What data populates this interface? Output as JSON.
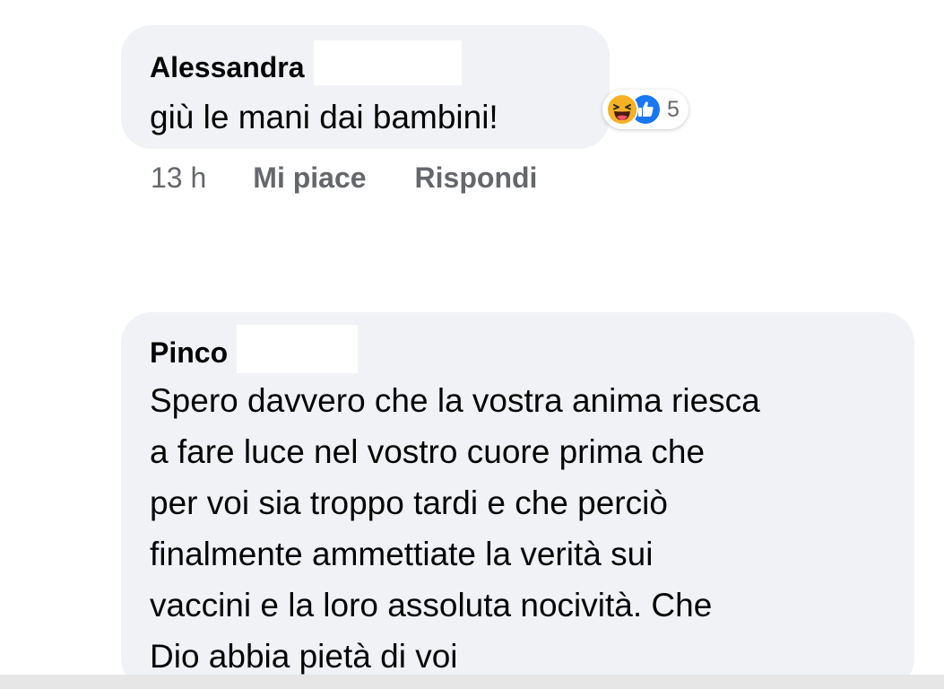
{
  "comments": [
    {
      "author": "Alessandra",
      "text_lines": [
        "giù le mani dai bambini!"
      ],
      "reactions": {
        "icons": [
          "haha-icon",
          "like-icon"
        ],
        "count": "5"
      },
      "actions": {
        "time": "13 h",
        "like_label": "Mi piace",
        "reply_label": "Rispondi"
      }
    },
    {
      "author": "Pinco",
      "text_lines": [
        "Spero davvero che la vostra anima riesca",
        "a fare luce nel vostro cuore prima che",
        "per voi sia troppo tardi e che perciò",
        "finalmente  ammettiate la verità  sui",
        "vaccini e la loro assoluta nocività. Che",
        "Dio abbia pietà  di voi"
      ]
    }
  ],
  "colors": {
    "bubble_bg": "#f0f2f5",
    "text": "#050505",
    "meta_text": "#65676b",
    "like_blue": "#1877f2",
    "haha_yellow": "#f7b125"
  }
}
